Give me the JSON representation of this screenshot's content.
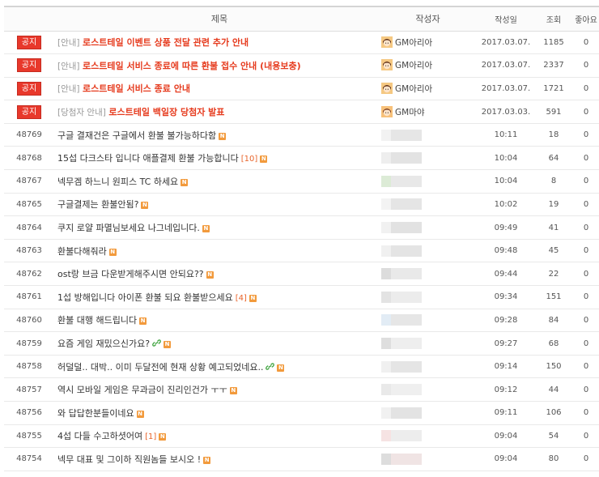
{
  "header": {
    "title": "제목",
    "author": "작성자",
    "date": "작성일",
    "views": "조회",
    "likes": "좋아요"
  },
  "notices": [
    {
      "badge": "공지",
      "prefix": "[안내]",
      "title": "로스트테일 이벤트 상품 전달 관련 추가 안내",
      "author": "GM아리아",
      "avatar": "aria",
      "date": "2017.03.07.",
      "views": "1185",
      "likes": "0"
    },
    {
      "badge": "공지",
      "prefix": "[안내]",
      "title": "로스트테일 서비스 종료에 따른 환불 접수 안내 (내용보충)",
      "author": "GM아리아",
      "avatar": "aria",
      "date": "2017.03.07.",
      "views": "2337",
      "likes": "0"
    },
    {
      "badge": "공지",
      "prefix": "[안내]",
      "title": "로스트테일 서비스 종료 안내",
      "author": "GM아리아",
      "avatar": "aria",
      "date": "2017.03.07.",
      "views": "1721",
      "likes": "0"
    },
    {
      "badge": "공지",
      "prefix": "[당첨자 안내]",
      "title": "로스트테일 백일장 당첨자 발표",
      "author": "GM마야",
      "avatar": "maya",
      "date": "2017.03.03.",
      "views": "591",
      "likes": "0"
    }
  ],
  "posts": [
    {
      "no": "48769",
      "title": "구글 결재건은 구글에서 환불 불가능하다함",
      "comments": "",
      "link": false,
      "new": true,
      "date": "10:11",
      "views": "18",
      "likes": "0",
      "blur": [
        "#f2f2f2",
        "#e6e6e6"
      ]
    },
    {
      "no": "48768",
      "title": "15섭 다크스타 입니다 애플결제 환불 가능합니다",
      "comments": "[10]",
      "link": false,
      "new": true,
      "date": "10:04",
      "views": "64",
      "likes": "0",
      "blur": [
        "#eeeeee",
        "#e3e3e3"
      ]
    },
    {
      "no": "48767",
      "title": "넥무겜 하느니 원피스 TC 하세요",
      "comments": "",
      "link": false,
      "new": true,
      "date": "10:04",
      "views": "8",
      "likes": "0",
      "blur": [
        "#dcebd6",
        "#e8e8e8"
      ]
    },
    {
      "no": "48765",
      "title": "구글결제는 환불안됨?",
      "comments": "",
      "link": false,
      "new": true,
      "date": "10:02",
      "views": "19",
      "likes": "0",
      "blur": [
        "#f3f3f3",
        "#e5e5e5"
      ]
    },
    {
      "no": "48764",
      "title": "쿠지 로얄 파멸님보세요 나그네입니다.",
      "comments": "",
      "link": false,
      "new": true,
      "date": "09:49",
      "views": "41",
      "likes": "0",
      "blur": [
        "#f1f1f1",
        "#e2e2e2"
      ]
    },
    {
      "no": "48763",
      "title": "환불다해줘라",
      "comments": "",
      "link": false,
      "new": true,
      "date": "09:48",
      "views": "45",
      "likes": "0",
      "blur": [
        "#f0f0f0",
        "#e4e4e4"
      ]
    },
    {
      "no": "48762",
      "title": "ost랑 브금 다운받게해주시면 안되요??",
      "comments": "",
      "link": false,
      "new": true,
      "date": "09:44",
      "views": "22",
      "likes": "0",
      "blur": [
        "#dcdcdc",
        "#e9e9e9"
      ]
    },
    {
      "no": "48761",
      "title": "1섭 방해입니다 아이폰 환불 되요 환불받으세요",
      "comments": "[4]",
      "link": false,
      "new": true,
      "date": "09:34",
      "views": "151",
      "likes": "0",
      "blur": [
        "#e3e3e3",
        "#ececec"
      ]
    },
    {
      "no": "48760",
      "title": "환불 대행 해드립니다",
      "comments": "",
      "link": false,
      "new": true,
      "date": "09:28",
      "views": "84",
      "likes": "0",
      "blur": [
        "#e2ecf5",
        "#e6e6e6"
      ]
    },
    {
      "no": "48759",
      "title": "요즘 게임 재밌으신가요?",
      "comments": "",
      "link": true,
      "new": true,
      "date": "09:27",
      "views": "68",
      "likes": "0",
      "blur": [
        "#dedede",
        "#eeeeee"
      ]
    },
    {
      "no": "48758",
      "title": "허덜덜.. 대박.. 이미 두달전에 현재 상황 예고되었네요..",
      "comments": "",
      "link": true,
      "new": true,
      "date": "09:14",
      "views": "150",
      "likes": "0",
      "blur": [
        "#f0f0f0",
        "#e5e5e5"
      ]
    },
    {
      "no": "48757",
      "title": "역시 모바일 게임은 무과금이 진리인건가 ㅜㅜ",
      "comments": "",
      "link": false,
      "new": true,
      "date": "09:12",
      "views": "44",
      "likes": "0",
      "blur": [
        "#e9e9e9",
        "#efefef"
      ]
    },
    {
      "no": "48756",
      "title": "와 답답한분들이네요",
      "comments": "",
      "link": false,
      "new": true,
      "date": "09:11",
      "views": "106",
      "likes": "0",
      "blur": [
        "#f1f1f1",
        "#e3e3e3"
      ]
    },
    {
      "no": "48755",
      "title": "4섭 다들 수고하셧어여",
      "comments": "[1]",
      "link": false,
      "new": true,
      "date": "09:04",
      "views": "54",
      "likes": "0",
      "blur": [
        "#f6e3e3",
        "#ededed"
      ]
    },
    {
      "no": "48754",
      "title": "넥무 대표 및 그이하 직원놈들 보시오 !",
      "comments": "",
      "link": false,
      "new": true,
      "date": "09:04",
      "views": "80",
      "likes": "0",
      "blur": [
        "#dddddd",
        "#f0e4e4"
      ]
    }
  ],
  "colors": {
    "notice_red": "#e8382b",
    "notice_title": "#e63b1e",
    "comment_orange": "#e8642b",
    "new_badge": "#f29a3c"
  },
  "icons": {
    "new": "new-badge-icon",
    "link": "link-icon",
    "avatar": "gm-avatar-icon"
  }
}
